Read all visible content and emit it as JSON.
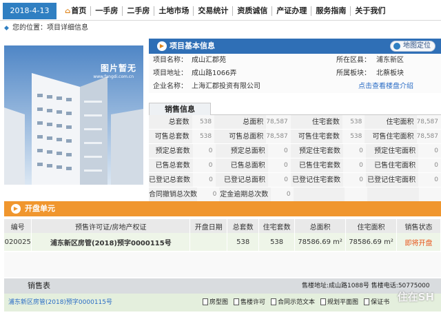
{
  "nav": {
    "date": "2018-4-13",
    "items": [
      "首页",
      "一手房",
      "二手房",
      "土地市场",
      "交易统计",
      "资质诚信",
      "产证办理",
      "服务指南",
      "关于我们"
    ]
  },
  "breadcrumb": "您的位置：项目详细信息",
  "photo": {
    "placeholder_text": "图片暂无",
    "placeholder_url": "www.fangdi.com.cn"
  },
  "project": {
    "header": "项目基本信息",
    "map_button": "地图定位",
    "name_label": "项目名称：",
    "name": "成山汇郡苑",
    "district_label": "所在区县：",
    "district": "浦东新区",
    "address_label": "项目地址：",
    "address": "成山路1066弄",
    "plate_label": "所属板块：",
    "plate": "北蔡板块",
    "company_label": "企业名称：",
    "company": "上海汇郡投资有限公司",
    "intro_link": "点击查看楼盘介绍"
  },
  "sales": {
    "tab": "销售信息",
    "rows": [
      [
        "总套数",
        "538",
        "总面积",
        "78,587",
        "住宅套数",
        "538",
        "住宅面积",
        "78,587"
      ],
      [
        "可售总套数",
        "538",
        "可售总面积",
        "78,587",
        "可售住宅套数",
        "538",
        "可售住宅面积",
        "78,587"
      ],
      [
        "预定总套数",
        "0",
        "预定总面积",
        "0",
        "预定住宅套数",
        "0",
        "预定住宅面积",
        "0"
      ],
      [
        "已售总套数",
        "0",
        "已售总面积",
        "0",
        "已售住宅套数",
        "0",
        "已售住宅面积",
        "0"
      ],
      [
        "已登记总套数",
        "0",
        "已登记总面积",
        "0",
        "已登记住宅套数",
        "0",
        "已登记住宅面积",
        "0"
      ],
      [
        "合同撤销总次数",
        "0",
        "定金逾期总次数",
        "0",
        "",
        "",
        "",
        ""
      ]
    ]
  },
  "units": {
    "header": "开盘单元",
    "columns": [
      "编号",
      "预售许可证/房地产权证",
      "开盘日期",
      "总套数",
      "住宅套数",
      "总面积",
      "住宅面积",
      "销售状态"
    ],
    "rows": [
      [
        "020025",
        "浦东新区房管(2018)预字0000115号",
        "",
        "538",
        "538",
        "78586.69 m²",
        "78586.69 m²",
        "即将开盘"
      ]
    ]
  },
  "footer": {
    "sales_table_label": "销售表",
    "address_phone": "售楼地址:成山路1088号 售楼电话:50775000",
    "cert_link": "浦东新区房管(2018)预字0000115号",
    "docs": [
      "房型图",
      "售楼许可",
      "合同示范文本",
      "规划平面图",
      "保证书"
    ],
    "watermark": "住在SH"
  },
  "colors": {
    "nav_blue": "#2f7fc2",
    "header_blue": "#2f6fb6",
    "orange": "#f0962e",
    "status_red": "#e8551a",
    "link_blue": "#2a6cc5"
  }
}
